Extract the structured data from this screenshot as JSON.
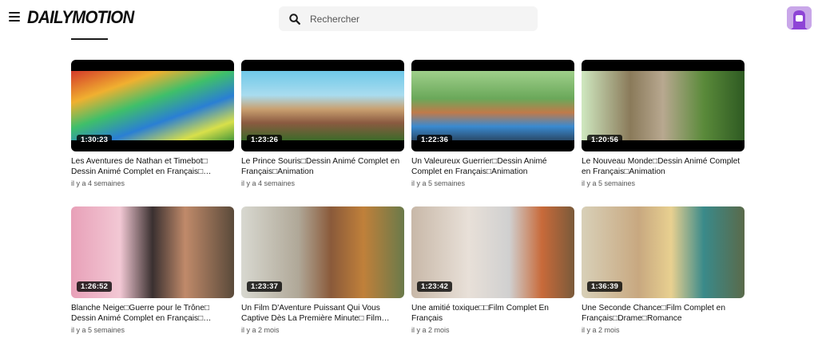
{
  "header": {
    "logo_text": "DAILYMOTION",
    "search_placeholder": "Rechercher"
  },
  "videos": [
    {
      "title": "Les Aventures de Nathan et Timebot□ Dessin Animé Complet en Français□…",
      "duration": "1:30:23",
      "date": "il y a 4 semaines"
    },
    {
      "title": "Le Prince Souris□Dessin Animé Complet en Français□Animation",
      "duration": "1:23:26",
      "date": "il y a 4 semaines"
    },
    {
      "title": "Un Valeureux Guerrier□Dessin Animé Complet en Français□Animation",
      "duration": "1:22:36",
      "date": "il y a 5 semaines"
    },
    {
      "title": "Le Nouveau Monde□Dessin Animé Complet en Français□Animation",
      "duration": "1:20:56",
      "date": "il y a 5 semaines"
    },
    {
      "title": "Blanche Neige□Guerre pour le Trône□ Dessin Animé Complet en Français□…",
      "duration": "1:26:52",
      "date": "il y a 5 semaines"
    },
    {
      "title": "Un Film D'Aventure Puissant Qui Vous Captive Dès La Première Minute□ Film…",
      "duration": "1:23:37",
      "date": "il y a 2 mois"
    },
    {
      "title": "Une amitié toxique□□Film Complet En Français",
      "duration": "1:23:42",
      "date": "il y a 2 mois"
    },
    {
      "title": "Une Seconde Chance□Film Complet en Français□Drame□Romance",
      "duration": "1:36:39",
      "date": "il y a 2 mois"
    }
  ],
  "colors": {
    "avatar_bg": "#c9a7e9",
    "avatar_fg": "#8e44d6"
  }
}
